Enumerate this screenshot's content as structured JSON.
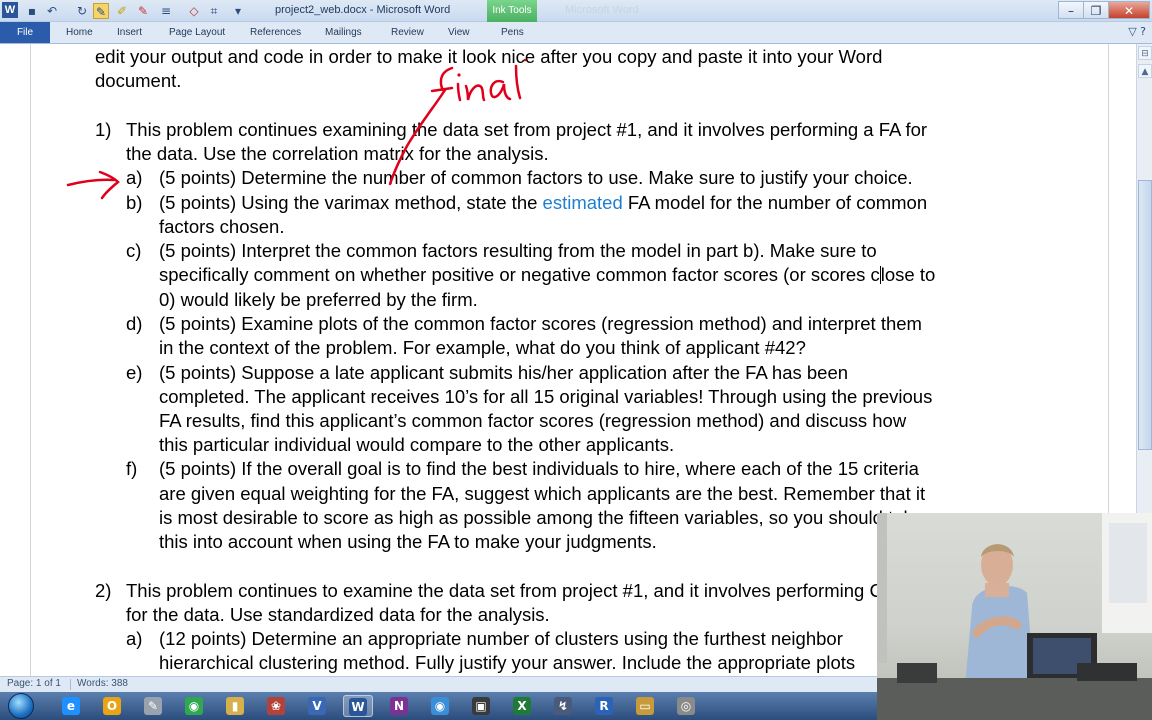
{
  "titlebar": {
    "title": "project2_web.docx - Microsoft Word",
    "context_tab": "Ink Tools",
    "ghost_title": "Microsoft Word",
    "minimize": "–",
    "restore": "❐",
    "close": "✕"
  },
  "ribbon": {
    "file": "File",
    "tabs": [
      "Home",
      "Insert",
      "Page Layout",
      "References",
      "Mailings",
      "Review",
      "View",
      "Pens"
    ],
    "help": "▽ ?"
  },
  "document": {
    "intro": [
      "edit your output and code in order to make it look nice after you copy and paste it into your Word",
      "document."
    ],
    "q1": {
      "num": "1)",
      "lines": [
        "This problem continues examining the data set from project #1, and it involves performing a FA for",
        "the data. Use the correlation matrix for the analysis."
      ]
    },
    "q1a": {
      "label": "a)",
      "text": "(5 points) Determine the number of common factors to use. Make sure to justify your choice."
    },
    "q1b": {
      "label": "b)",
      "text_pre": "(5 points) Using the varimax method, state the ",
      "link": "estimated",
      "text_post": " FA model for the number of common",
      "line2": "factors chosen."
    },
    "q1c": {
      "label": "c)",
      "line1": "(5 points) Interpret the common factors resulting from the model in part b). Make sure to",
      "line2_pre": "specifically comment on whether positive or negative common factor scores (or scores c",
      "line2_post": "lose to",
      "line3": "0) would likely be preferred by the firm."
    },
    "q1d": {
      "label": "d)",
      "lines": [
        "(5 points) Examine plots of the common factor scores (regression method) and interpret them",
        "in the context of the problem. For example, what do you think of applicant #42?"
      ]
    },
    "q1e": {
      "label": "e)",
      "lines": [
        "(5 points) Suppose a late applicant submits his/her application after the FA has been",
        "completed. The applicant receives 10’s for all 15 original variables! Through using the previous",
        "FA results, find this applicant’s common factor scores (regression method) and discuss how",
        "this particular individual would compare to the other applicants."
      ]
    },
    "q1f": {
      "label": "f)",
      "lines": [
        "(5 points) If the overall goal is to find the best individuals to hire, where each of the 15 criteria",
        "are given equal weighting for the FA, suggest which applicants are the best. Remember that it",
        "is most desirable to score as high as possible among the fifteen variables, so you should take",
        "this into account when using the FA to make your judgments."
      ]
    },
    "q2": {
      "num": "2)",
      "lines": [
        "This problem continues to examine the data set from project #1, and it involves performing CA",
        "for the data. Use standardized data for the analysis."
      ]
    },
    "q2a": {
      "label": "a)",
      "lines": [
        "(12 points) Determine an appropriate number of clusters using the furthest neighbor",
        "hierarchical clustering method. Fully justify your answer. Include the appropriate plots"
      ]
    },
    "ink_word": "final"
  },
  "status": {
    "page": "Page: 1 of 1",
    "words": "Words: 388"
  },
  "taskbar": {
    "icons": [
      "ie-icon",
      "outlook-icon",
      "pen-icon",
      "chrome-icon",
      "folder-icon",
      "media-icon",
      "visio-icon",
      "word-icon",
      "onenote-icon",
      "browser-icon",
      "cmd-icon",
      "excel-icon",
      "remote-icon",
      "r-icon",
      "explorer-icon",
      "misc-icon"
    ],
    "labels": [
      "e",
      "O",
      "✎",
      "◉",
      "▮",
      "❀",
      "V",
      "W",
      "N",
      "◉",
      "▣",
      "X",
      "↯",
      "R",
      "▭",
      "◎"
    ]
  },
  "colors": {
    "link": "#1f7fd0",
    "ink": "#e0001b"
  }
}
